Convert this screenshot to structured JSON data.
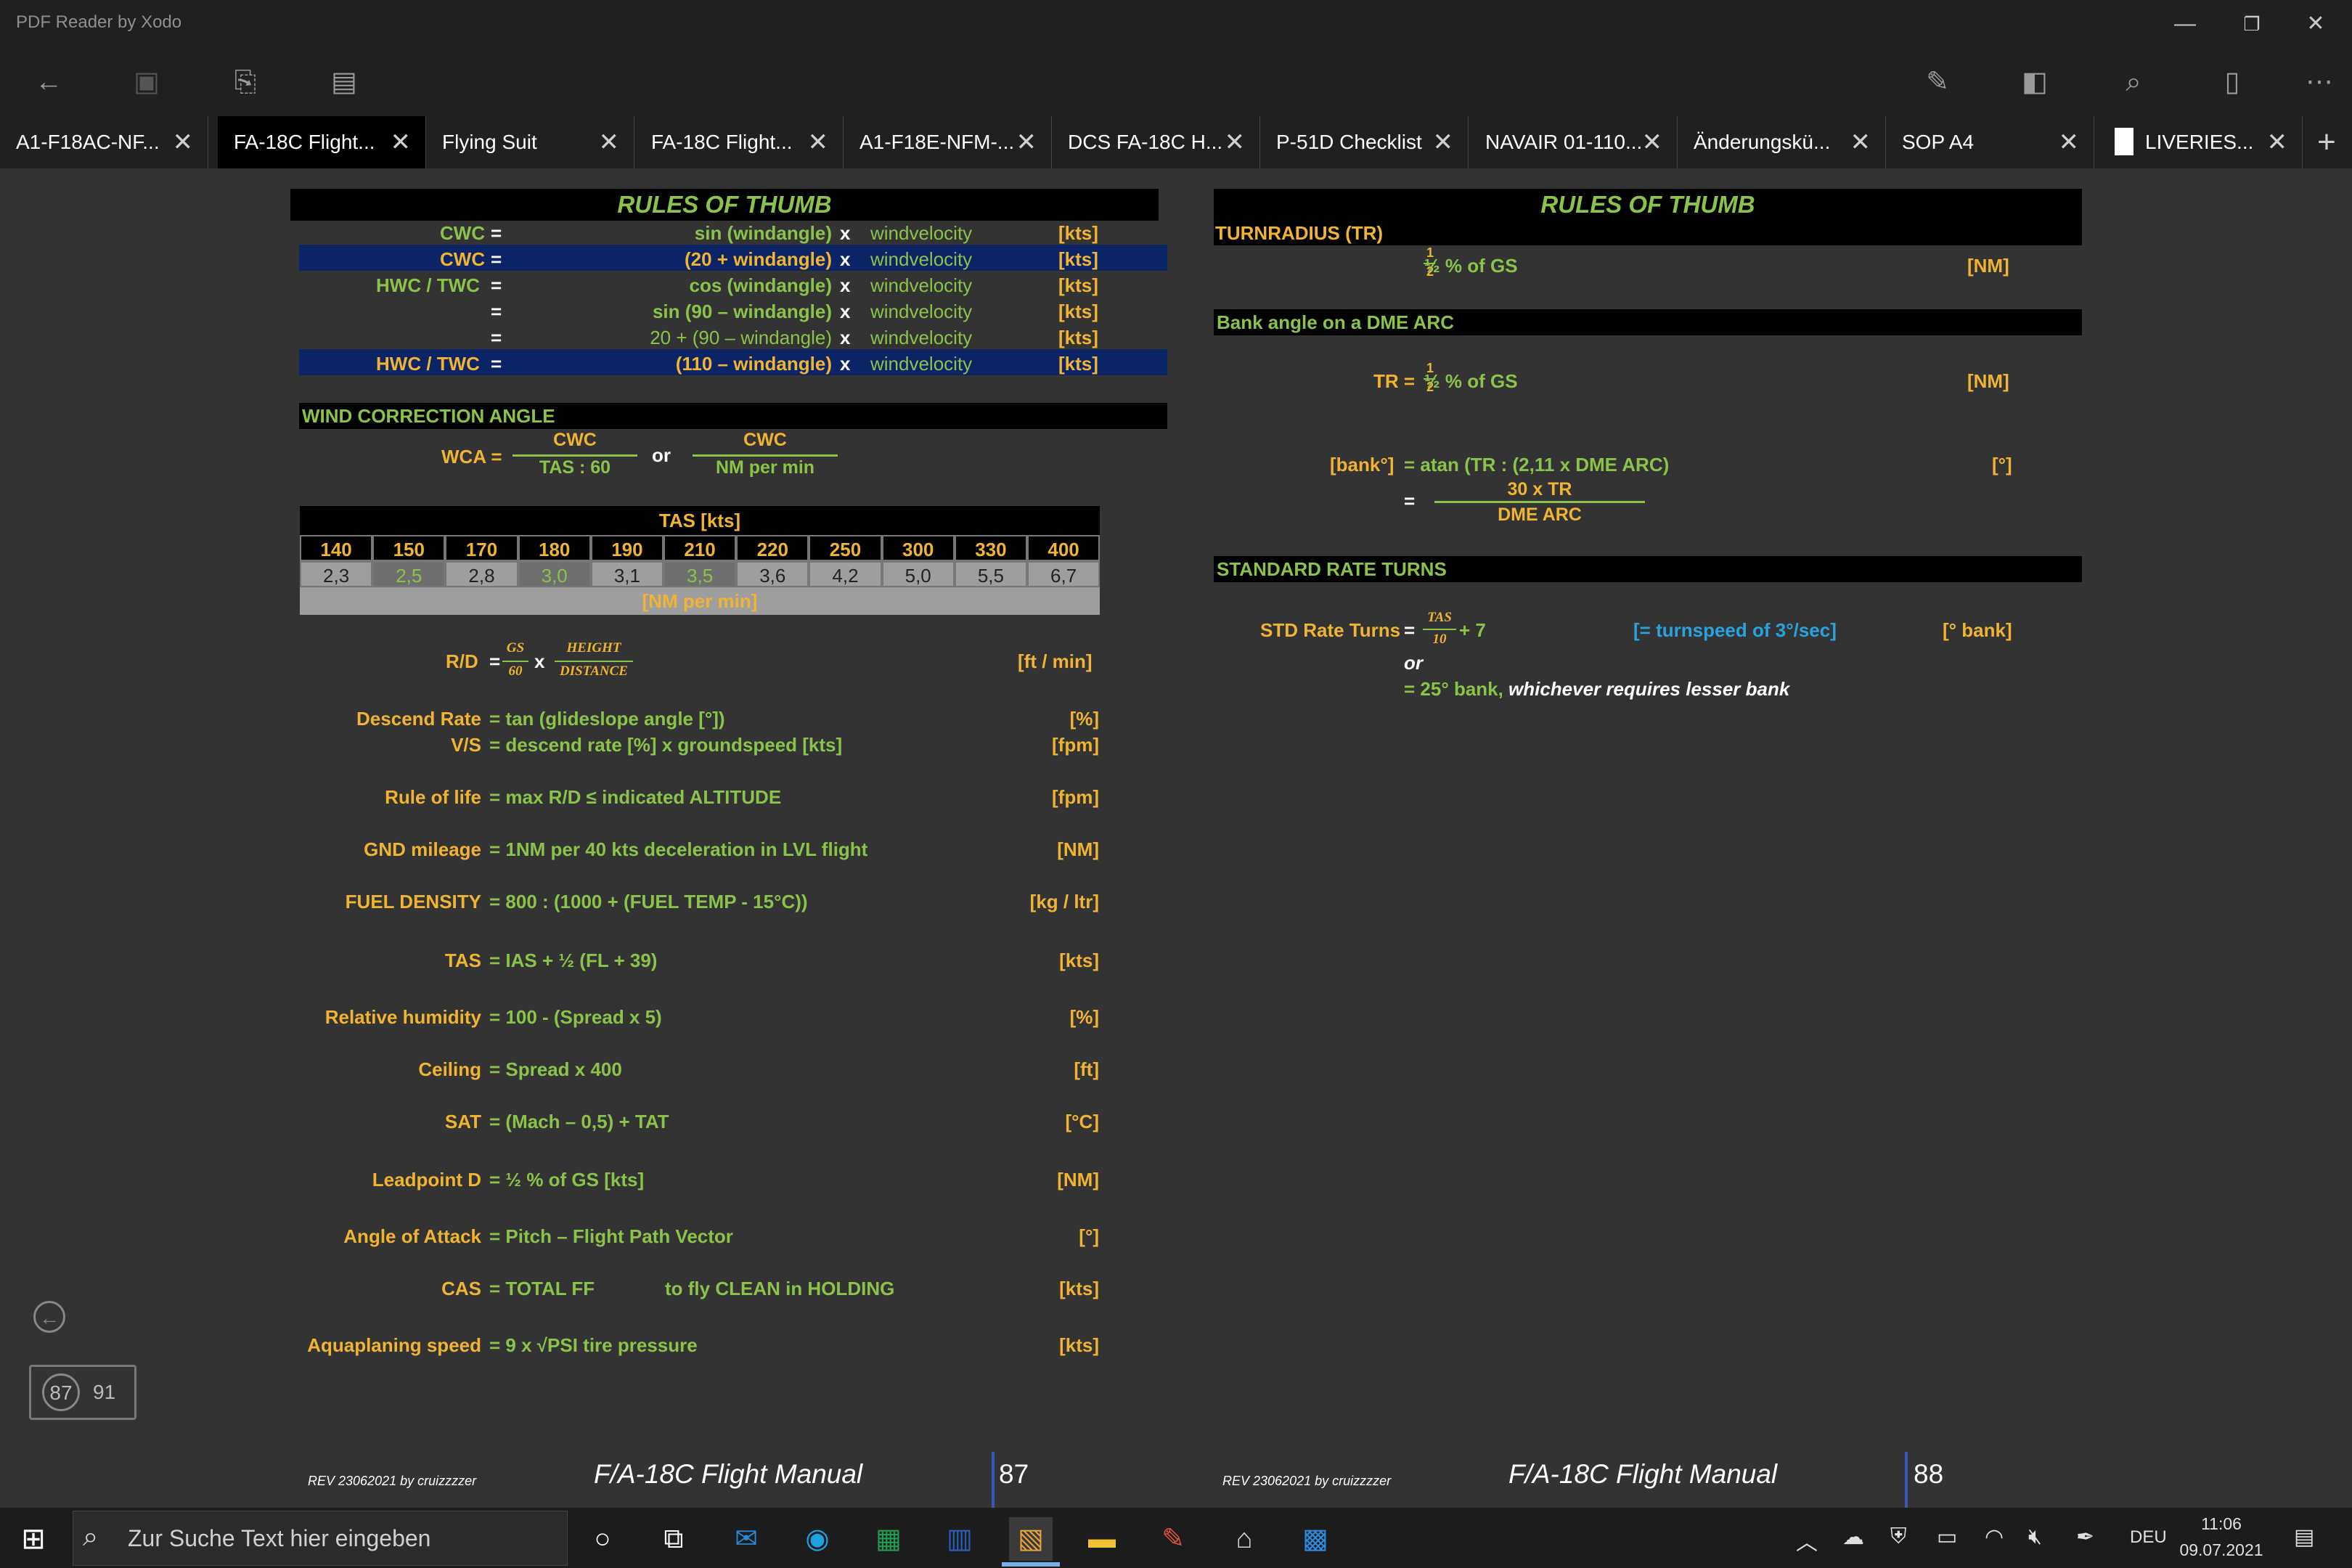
{
  "window": {
    "title": "PDF Reader by Xodo"
  },
  "tabs": [
    {
      "label": "A1-F18AC-NF...",
      "active": false
    },
    {
      "label": "FA-18C Flight...",
      "active": true
    },
    {
      "label": "Flying Suit",
      "active": false
    },
    {
      "label": "FA-18C Flight...",
      "active": false
    },
    {
      "label": "A1-F18E-NFM-...",
      "active": false
    },
    {
      "label": "DCS FA-18C H...",
      "active": false
    },
    {
      "label": "P-51D Checklist",
      "active": false
    },
    {
      "label": "NAVAIR 01-110...",
      "active": false
    },
    {
      "label": "Änderungskü...",
      "active": false
    },
    {
      "label": "SOP A4",
      "active": false
    },
    {
      "label": "LIVERIES...",
      "active": false
    }
  ],
  "page87": {
    "title": "RULES OF THUMB",
    "wind_rows": [
      {
        "lhs": "CWC",
        "eq": "=",
        "fn": "sin (windangle)",
        "x": "x",
        "var": "windvelocity",
        "unit": "[kts]"
      },
      {
        "lhs": "CWC",
        "eq": "=",
        "fn": "(20 + windangle)",
        "x": "x",
        "var": "windvelocity",
        "unit": "[kts]"
      },
      {
        "lhs": "HWC / TWC",
        "eq": "=",
        "fn": "cos (windangle)",
        "x": "x",
        "var": "windvelocity",
        "unit": "[kts]"
      },
      {
        "lhs": "",
        "eq": "=",
        "fn": "sin (90 – windangle)",
        "x": "x",
        "var": "windvelocity",
        "unit": "[kts]"
      },
      {
        "lhs": "",
        "eq": "=",
        "fn": "20 + (90 – windangle)",
        "x": "x",
        "var": "windvelocity",
        "unit": "[kts]"
      },
      {
        "lhs": "HWC / TWC",
        "eq": "=",
        "fn": "(110 – windangle)",
        "x": "x",
        "var": "windvelocity",
        "unit": "[kts]"
      }
    ],
    "wca": {
      "header": "WIND CORRECTION ANGLE",
      "lhs": "WCA =",
      "num1": "CWC",
      "den1": "TAS : 60",
      "or": "or",
      "num2": "CWC",
      "den2": "NM per min"
    },
    "tas_table": {
      "header": "TAS [kts]",
      "speeds": [
        "140",
        "150",
        "170",
        "180",
        "190",
        "210",
        "220",
        "250",
        "300",
        "330",
        "400"
      ],
      "nm_per_min": [
        "2,3",
        "2,5",
        "2,8",
        "3,0",
        "3,1",
        "3,5",
        "3,6",
        "4,2",
        "5,0",
        "5,5",
        "6,7"
      ],
      "footer": "[NM per min]"
    },
    "rd": {
      "lhs": "R/D",
      "eq": "=",
      "num1": "GS",
      "den1": "60",
      "x": "x",
      "num2": "HEIGHT",
      "den2": "DISTANCE",
      "unit": "[ft / min]"
    },
    "formulas": [
      {
        "lhs": "Descend Rate",
        "rhs": "= tan (glideslope angle [°])",
        "unit": "[%]"
      },
      {
        "lhs": "V/S",
        "rhs": "= descend rate [%] x groundspeed [kts]",
        "unit": "[fpm]"
      },
      {
        "lhs": "Rule of life",
        "rhs": "= max R/D ≤ indicated ALTITUDE",
        "unit": "[fpm]"
      },
      {
        "lhs": "GND mileage",
        "rhs": "= 1NM per 40 kts deceleration in LVL flight",
        "unit": "[NM]"
      },
      {
        "lhs": "FUEL DENSITY",
        "rhs": "= 800 : (1000 + (FUEL TEMP - 15°C))",
        "unit": "[kg / ltr]"
      },
      {
        "lhs": "TAS",
        "rhs": "= IAS + ½ (FL + 39)",
        "unit": "[kts]"
      },
      {
        "lhs": "Relative humidity",
        "rhs": "= 100 - (Spread x 5)",
        "unit": "[%]"
      },
      {
        "lhs": "Ceiling",
        "rhs": "= Spread x 400",
        "unit": "[ft]"
      },
      {
        "lhs": "SAT",
        "rhs": "= (Mach – 0,5) + TAT",
        "unit": "[°C]"
      },
      {
        "lhs": "Leadpoint D",
        "rhs": "= ½ % of GS [kts]",
        "unit": "[NM]"
      },
      {
        "lhs": "Angle of Attack",
        "rhs": "= Pitch – Flight Path Vector",
        "unit": "[°]"
      },
      {
        "lhs": "CAS",
        "rhs": "= TOTAL FF",
        "extra": "to fly CLEAN in HOLDING",
        "unit": "[kts]"
      },
      {
        "lhs": "Aquaplaning speed",
        "rhs": "= 9 x √PSI tire pressure",
        "unit": "[kts]"
      }
    ],
    "footer": {
      "rev": "REV 23062021 by cruizzzzer",
      "manual": "F/A-18C Flight Manual",
      "page": "87"
    }
  },
  "page88": {
    "title": "RULES OF THUMB",
    "turnradius": {
      "header": "TURNRADIUS (TR)",
      "formula": "½ % of GS",
      "unit": "[NM]"
    },
    "dme": {
      "header": "Bank angle on a DME ARC",
      "tr_lhs": "TR  =",
      "tr_formula": "½ % of GS",
      "tr_unit": "[NM]",
      "bank_lhs": "[bank°]",
      "bank_formula": "= atan (TR : (2,11 x DME ARC)",
      "bank_unit": "[°]",
      "eq2": "=",
      "num": "30 x TR",
      "den": "DME ARC"
    },
    "std": {
      "header": "STANDARD RATE TURNS",
      "lhs": "STD Rate Turns",
      "eq": "=",
      "num": "TAS",
      "den": "10",
      "plus": "+ 7",
      "note": "[= turnspeed of 3°/sec]",
      "unit": "[° bank]",
      "or": "or",
      "alt_prefix": "= 25° bank,",
      "alt_suffix": "whichever requires lesser bank"
    },
    "footer": {
      "rev": "REV 23062021 by cruizzzzer",
      "manual": "F/A-18C Flight Manual",
      "page": "88"
    }
  },
  "page_indicator": {
    "current": "87",
    "total": "91"
  },
  "taskbar": {
    "search_placeholder": "Zur Suche Text hier eingeben",
    "lang": "DEU",
    "time": "11:06",
    "date": "09.07.2021"
  }
}
